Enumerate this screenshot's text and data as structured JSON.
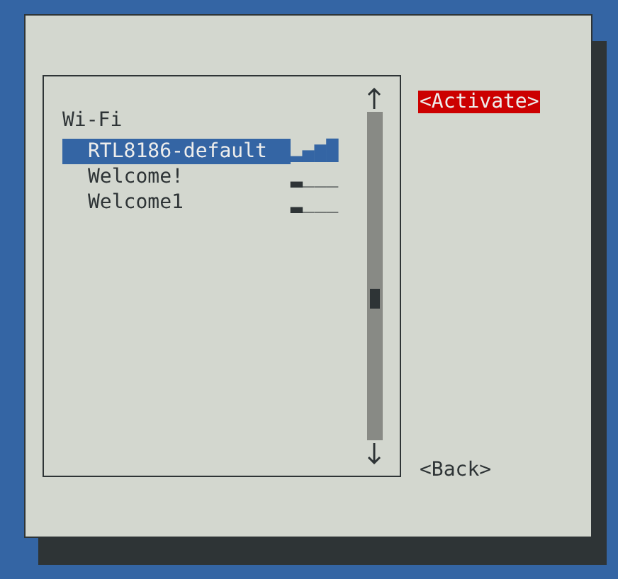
{
  "list": {
    "heading": "Wi-Fi",
    "networks": [
      {
        "name": "RTL8186-default",
        "signal": "▂▄▆█",
        "selected": true
      },
      {
        "name": "Welcome!",
        "signal": "▂___",
        "selected": false
      },
      {
        "name": "Welcome1",
        "signal": "▂___",
        "selected": false
      }
    ]
  },
  "buttons": [
    {
      "label": "<Activate>",
      "selected": true
    },
    {
      "label": "<Back>",
      "selected": false
    }
  ]
}
